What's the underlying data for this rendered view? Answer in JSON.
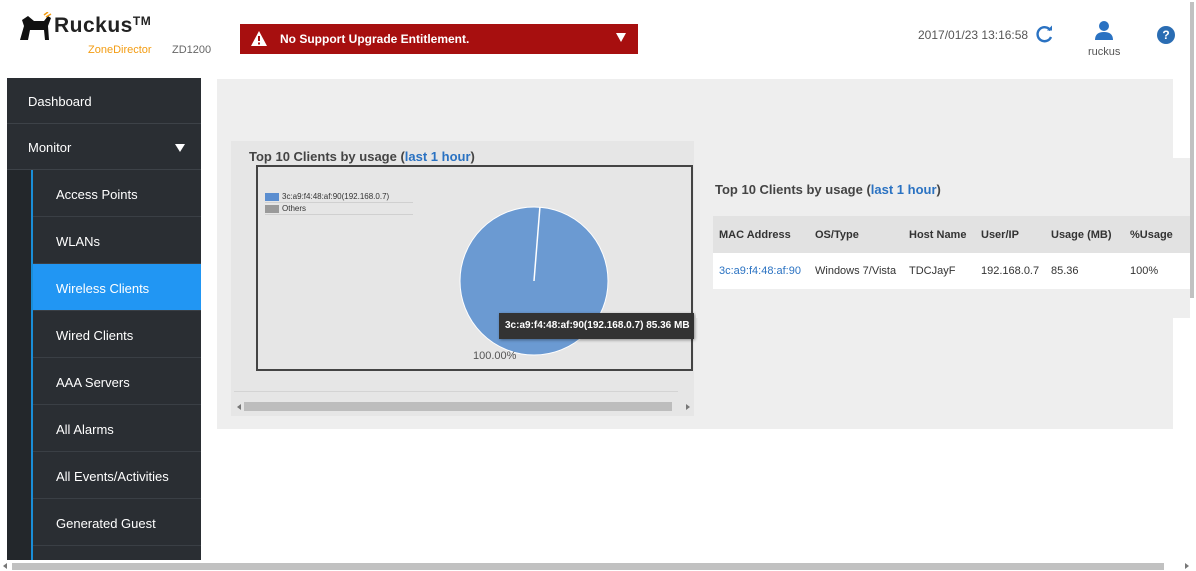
{
  "header": {
    "brand": "Ruckus",
    "brand_tm": "TM",
    "product": "ZoneDirector",
    "model": "ZD1200",
    "alert_text": "No Support Upgrade Entitlement.",
    "datetime": "2017/01/23 13:16:58",
    "user_label": "ruckus",
    "help_glyph": "?",
    "refresh_icon": "refresh-icon",
    "alert_color": "#a70f0f"
  },
  "sidebar": {
    "dashboard": "Dashboard",
    "monitor": "Monitor",
    "items": [
      {
        "label": "Access Points"
      },
      {
        "label": "WLANs"
      },
      {
        "label": "Wireless Clients",
        "active": true
      },
      {
        "label": "Wired Clients"
      },
      {
        "label": "AAA Servers"
      },
      {
        "label": "All Alarms"
      },
      {
        "label": "All Events/Activities"
      },
      {
        "label": "Generated Guest"
      }
    ],
    "accent": "#2196f3"
  },
  "pie_widget": {
    "title": "Top 10 Clients by usage (",
    "link": "last 1 hour",
    "title_end": ")",
    "percent_label": "100.00%",
    "tooltip": "3c:a9:f4:48:af:90(192.168.0.7) 85.36 MB",
    "legend": [
      {
        "label": "3c:a9:f4:48:af:90(192.168.0.7)",
        "color": "#5b8ed0"
      },
      {
        "label": "Others",
        "color": "#9a9a9a"
      }
    ]
  },
  "chart_data": {
    "type": "pie",
    "title": "Top 10 Clients by usage (last 1 hour)",
    "slices": [
      {
        "label": "3c:a9:f4:48:af:90(192.168.0.7)",
        "value": 85.36,
        "percent": 100.0,
        "color": "#6b9ad2"
      },
      {
        "label": "Others",
        "value": 0,
        "percent": 0.0,
        "color": "#9a9a9a"
      }
    ],
    "unit": "MB"
  },
  "table_widget": {
    "title": "Top 10 Clients by usage (",
    "link": "last 1 hour",
    "title_end": ")",
    "columns": [
      "MAC Address",
      "OS/Type",
      "Host Name",
      "User/IP",
      "Usage (MB)",
      "%Usage"
    ],
    "rows": [
      [
        "3c:a9:f4:48:af:90",
        "Windows 7/Vista",
        "TDCJayF",
        "192.168.0.7",
        "85.36",
        "100%"
      ]
    ]
  }
}
